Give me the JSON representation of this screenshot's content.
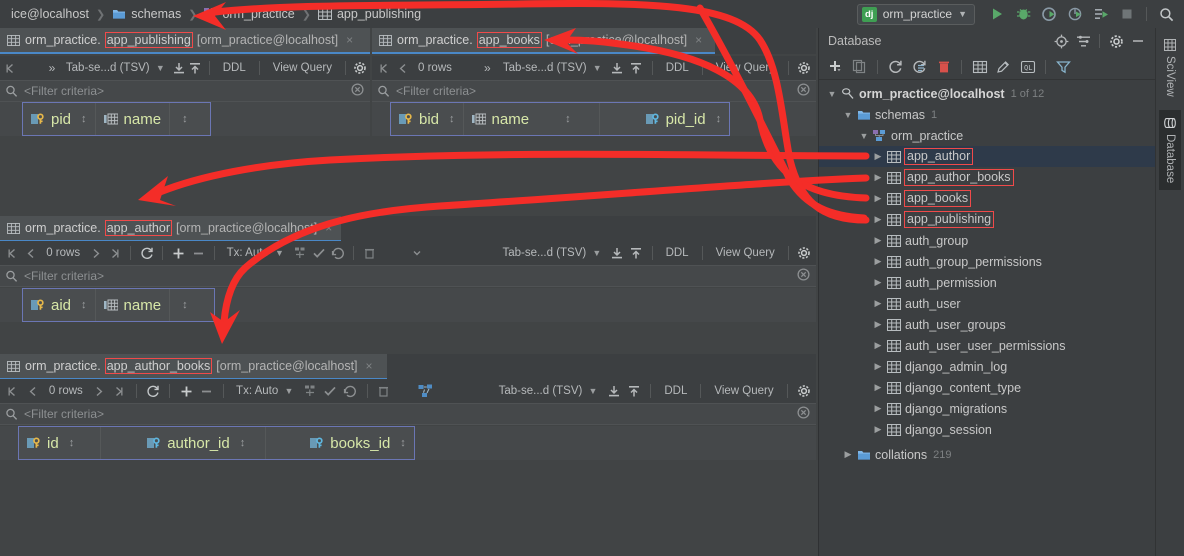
{
  "window": {
    "title": "DataGrip / PyCharm Database Console"
  },
  "breadcrumb": {
    "items": [
      {
        "label": "ice@localhost",
        "icon": "db-icon"
      },
      {
        "label": "schemas",
        "icon": "folder-icon"
      },
      {
        "label": "orm_practice",
        "icon": "schema-icon"
      },
      {
        "label": "app_publishing",
        "icon": "table-icon"
      }
    ]
  },
  "topbar": {
    "run_config": "orm_practice",
    "run_config_badge": "dj",
    "buttons": [
      {
        "name": "run-button",
        "label": "Run"
      },
      {
        "name": "debug-button",
        "label": "Debug"
      },
      {
        "name": "coverage-button",
        "label": "Run with Coverage"
      },
      {
        "name": "profile-button",
        "label": "Profile"
      },
      {
        "name": "run-manage-task-button",
        "label": "Run manage.py Task"
      },
      {
        "name": "stop-button",
        "label": "Stop"
      },
      {
        "name": "search-everywhere-button",
        "label": "Search Everywhere"
      }
    ]
  },
  "editors": [
    {
      "id": "app_publishing",
      "tab": {
        "table": "orm_practice.app_publishing",
        "schema_prefix": "orm_practice.",
        "table_name": "app_publishing",
        "connection": "[orm_practice@localhost]",
        "close": "×",
        "highlight": true
      },
      "toolbar": {
        "first_page": "⏮",
        "prev_page": "‹",
        "rows": "",
        "next_page": "›",
        "last_page": "⏭",
        "more": "»",
        "format": "Tab-se...d (TSV)",
        "import": "import-icon",
        "export": "export-icon",
        "ddl": "DDL",
        "view_query": "View Query",
        "settings": "gear-icon"
      },
      "filter_placeholder": "<Filter criteria>",
      "columns": [
        {
          "name": "pid",
          "icon": "primary-key-icon"
        },
        {
          "name": "name",
          "icon": "column-icon"
        }
      ]
    },
    {
      "id": "app_books",
      "tab": {
        "table": "orm_practice.app_books",
        "schema_prefix": "orm_practice.",
        "table_name": "app_books",
        "connection": "[orm_practice@localhost]",
        "close": "×",
        "highlight": true
      },
      "toolbar": {
        "first_page": "⏮",
        "prev_page": "‹",
        "rows": "0 rows",
        "next_page": "›",
        "last_page": "⏭",
        "more": "»",
        "format": "Tab-se...d (TSV)",
        "ddl": "DDL",
        "view_query": "View Query",
        "settings": "gear-icon"
      },
      "filter_placeholder": "<Filter criteria>",
      "columns": [
        {
          "name": "bid",
          "icon": "primary-key-icon"
        },
        {
          "name": "name",
          "icon": "column-icon"
        },
        {
          "name": "pid_id",
          "icon": "foreign-key-icon"
        }
      ]
    },
    {
      "id": "app_author",
      "tab": {
        "table": "orm_practice.app_author",
        "schema_prefix": "orm_practice.",
        "table_name": "app_author",
        "connection": "[orm_practice@localhost]",
        "close": "×",
        "highlight": true
      },
      "toolbar": {
        "rows": "0 rows",
        "tx": "Tx: Auto",
        "format": "Tab-se...d (TSV)",
        "ddl": "DDL",
        "view_query": "View Query"
      },
      "filter_placeholder": "<Filter criteria>",
      "columns": [
        {
          "name": "aid",
          "icon": "primary-key-icon"
        },
        {
          "name": "name",
          "icon": "column-icon"
        }
      ]
    },
    {
      "id": "app_author_books",
      "tab": {
        "table": "orm_practice.app_author_books",
        "schema_prefix": "orm_practice.",
        "table_name": "app_author_books",
        "connection": "[orm_practice@localhost]",
        "close": "×",
        "highlight": true
      },
      "toolbar": {
        "rows": "0 rows",
        "tx": "Tx: Auto",
        "format": "Tab-se...d (TSV)",
        "ddl": "DDL",
        "view_query": "View Query"
      },
      "filter_placeholder": "<Filter criteria>",
      "columns": [
        {
          "name": "id",
          "icon": "primary-key-icon"
        },
        {
          "name": "author_id",
          "icon": "foreign-key-icon"
        },
        {
          "name": "books_id",
          "icon": "foreign-key-icon"
        }
      ]
    }
  ],
  "database_panel": {
    "title": "Database",
    "header_buttons": [
      {
        "name": "jump-to-console-button",
        "label": "Jump to Console"
      },
      {
        "name": "collapse-all-button",
        "label": "Collapse All"
      },
      {
        "name": "settings-button",
        "label": "Settings"
      },
      {
        "name": "hide-button",
        "label": "Hide"
      }
    ],
    "toolbar_buttons": [
      {
        "name": "add-button",
        "label": "New"
      },
      {
        "name": "copy-button",
        "label": "Duplicate"
      },
      {
        "name": "refresh-button",
        "label": "Refresh"
      },
      {
        "name": "sync-button",
        "label": "Synchronize"
      },
      {
        "name": "drop-button",
        "label": "Drop"
      },
      {
        "name": "table-editor-button",
        "label": "Table Editor"
      },
      {
        "name": "modify-button",
        "label": "Modify"
      },
      {
        "name": "query-console-button",
        "label": "Query Console"
      },
      {
        "name": "filter-button",
        "label": "Filter"
      }
    ],
    "tree": [
      {
        "level": 0,
        "label": "orm_practice@localhost",
        "count": "1 of 12",
        "icon": "datasource-icon",
        "expanded": true,
        "bold": true
      },
      {
        "level": 1,
        "label": "schemas",
        "count": "1",
        "icon": "folder-icon",
        "expanded": true
      },
      {
        "level": 2,
        "label": "orm_practice",
        "count": "",
        "icon": "schema-icon",
        "expanded": true
      },
      {
        "level": 3,
        "label": "app_author",
        "count": "",
        "icon": "table-icon",
        "expanded": false,
        "selected": true,
        "highlight": true
      },
      {
        "level": 3,
        "label": "app_author_books",
        "count": "",
        "icon": "table-icon",
        "expanded": false,
        "highlight": true
      },
      {
        "level": 3,
        "label": "app_books",
        "count": "",
        "icon": "table-icon",
        "expanded": false,
        "highlight": true
      },
      {
        "level": 3,
        "label": "app_publishing",
        "count": "",
        "icon": "table-icon",
        "expanded": false,
        "highlight": true
      },
      {
        "level": 3,
        "label": "auth_group",
        "count": "",
        "icon": "table-icon",
        "expanded": false
      },
      {
        "level": 3,
        "label": "auth_group_permissions",
        "count": "",
        "icon": "table-icon",
        "expanded": false
      },
      {
        "level": 3,
        "label": "auth_permission",
        "count": "",
        "icon": "table-icon",
        "expanded": false
      },
      {
        "level": 3,
        "label": "auth_user",
        "count": "",
        "icon": "table-icon",
        "expanded": false
      },
      {
        "level": 3,
        "label": "auth_user_groups",
        "count": "",
        "icon": "table-icon",
        "expanded": false
      },
      {
        "level": 3,
        "label": "auth_user_user_permissions",
        "count": "",
        "icon": "table-icon",
        "expanded": false
      },
      {
        "level": 3,
        "label": "django_admin_log",
        "count": "",
        "icon": "table-icon",
        "expanded": false
      },
      {
        "level": 3,
        "label": "django_content_type",
        "count": "",
        "icon": "table-icon",
        "expanded": false
      },
      {
        "level": 3,
        "label": "django_migrations",
        "count": "",
        "icon": "table-icon",
        "expanded": false
      },
      {
        "level": 3,
        "label": "django_session",
        "count": "",
        "icon": "table-icon",
        "expanded": false
      },
      {
        "level": 1,
        "label": "collations",
        "count": "219",
        "icon": "folder-icon",
        "expanded": false
      }
    ]
  },
  "tool_tabs": [
    {
      "label": "SciView",
      "active": false,
      "icon": "sciview-icon"
    },
    {
      "label": "Database",
      "active": true,
      "icon": "database-icon"
    }
  ],
  "colors": {
    "background": "#414445",
    "panel": "#3c3f41",
    "header_row": "#45484a",
    "tab_active": "#4e5254",
    "tab_underline": "#4a88c7",
    "column_text": "#d7e7a8",
    "annotation": "#f42d28",
    "selection": "#2e3a4a",
    "grid_border": "#6b76b4",
    "accent_green": "#3f9f53"
  }
}
